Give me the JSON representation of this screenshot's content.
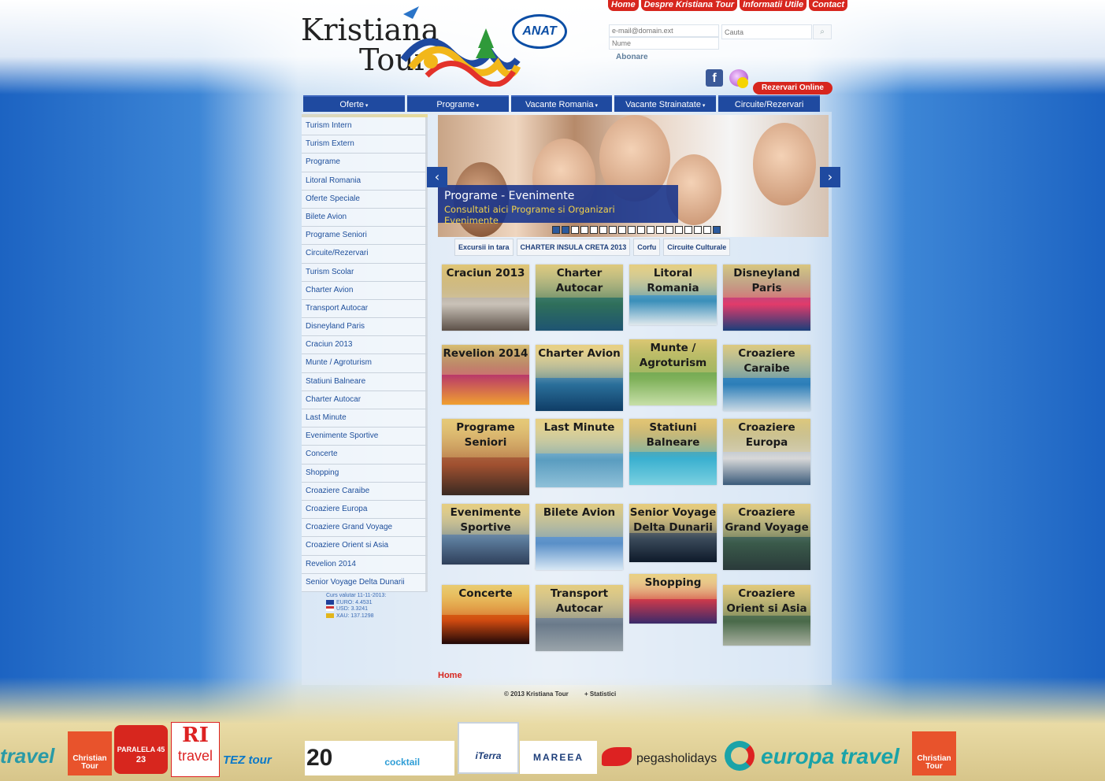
{
  "logo": {
    "line1": "Kristiana",
    "line2": "Tour",
    "badge": "ANAT"
  },
  "topnav": [
    "Home",
    "Despre Kristiana Tour",
    "Informatii Utile",
    "Contact"
  ],
  "newsletter": {
    "email_placeholder": "e-mail@domain.ext",
    "name_placeholder": "Nume",
    "subscribe_label": "Abonare"
  },
  "search": {
    "placeholder": "Cauta"
  },
  "social": {
    "facebook": "f"
  },
  "rezervari_label": "Rezervari Online",
  "mainnav": [
    "Oferte",
    "Programe",
    "Vacante Romania",
    "Vacante Strainatate",
    "Circuite/Rezervari"
  ],
  "sidebar": [
    "Turism Intern",
    "Turism Extern",
    "Programe",
    "Litoral Romania",
    "Oferte Speciale",
    "Bilete Avion",
    "Programe Seniori",
    "Circuite/Rezervari",
    "Turism Scolar",
    "Charter Avion",
    "Transport Autocar",
    "Disneyland Paris",
    "Craciun 2013",
    "Munte / Agroturism",
    "Statiuni Balneare",
    "Charter Autocar",
    "Last Minute",
    "Evenimente Sportive",
    "Concerte",
    "Shopping",
    "Croaziere Caraibe",
    "Croaziere Europa",
    "Croaziere Grand Voyage",
    "Croaziere Orient si Asia",
    "Revelion 2014",
    "Senior Voyage Delta Dunarii"
  ],
  "curs": {
    "title": "Curs valutar 11-11-2013:",
    "euro": "EURO: 4.4531",
    "usd": "USD: 3.3241",
    "xau": "XAU: 137.1298"
  },
  "slider": {
    "title": "Programe - Evenimente",
    "subtitle": "Consultati aici Programe si Organizari Evenimente",
    "prev": "‹",
    "next": "›"
  },
  "subtabs": [
    "Excursii in tara",
    "CHARTER INSULA CRETA 2013",
    "Corfu",
    "Circuite Culturale"
  ],
  "tiles": [
    [
      "Craciun 2013",
      "Charter Autocar",
      "Litoral Romania",
      "Disneyland Paris"
    ],
    [
      "Revelion 2014",
      "Charter Avion",
      "Munte / Agroturism",
      "Croaziere Caraibe"
    ],
    [
      "Programe Seniori",
      "Last Minute",
      "Statiuni Balneare",
      "Croaziere Europa"
    ],
    [
      "Evenimente Sportive",
      "Bilete Avion",
      "Senior Voyage Delta Dunarii",
      "Croaziere Grand Voyage"
    ],
    [
      "Concerte",
      "Transport Autocar",
      "Shopping",
      "Croaziere Orient si Asia"
    ]
  ],
  "breadcrumb": "Home",
  "footer": {
    "copyright": "© 2013 Kristiana Tour",
    "stats": "+ Statistici"
  },
  "partners": {
    "travel": "travel",
    "christian": "Christian Tour",
    "paralela": "PARALELA 45",
    "paralela_years": "23",
    "ri_travel": "travel",
    "ri": "RI",
    "tez": "TEZ tour",
    "twenty": "20",
    "cocktail": "cocktail holidays",
    "iterra": "iTerra",
    "mareea": "MAREEA",
    "pegas": "pegasholidays",
    "europa": "europa travel",
    "christian2": "Christian Tour"
  },
  "colors": {
    "nav": "#1f4aa0",
    "accent": "#d7261e",
    "link": "#1d4e9b",
    "caption_sub": "#f2d24a"
  }
}
